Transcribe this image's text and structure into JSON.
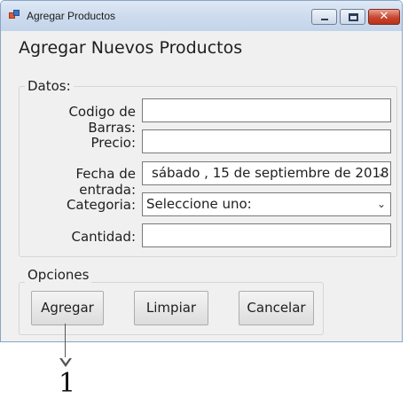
{
  "window": {
    "title": "Agregar Productos",
    "close_glyph": "✕"
  },
  "heading": "Agregar Nuevos Productos",
  "datos": {
    "legend": "Datos:",
    "fields": {
      "barcode": {
        "label": "Codigo de Barras:",
        "value": ""
      },
      "price": {
        "label": "Precio:",
        "value": ""
      },
      "date": {
        "label": "Fecha de entrada:",
        "value": "sábado  , 15 de septiembre de 2018"
      },
      "category": {
        "label": "Categoria:",
        "value": "Seleccione uno:"
      },
      "quantity": {
        "label": "Cantidad:",
        "value": ""
      }
    }
  },
  "opciones": {
    "legend": "Opciones",
    "buttons": {
      "add": "Agregar",
      "clear": "Limpiar",
      "cancel": "Cancelar"
    }
  },
  "annotation": {
    "number": "1"
  },
  "icons": {
    "app": "app-window-icon",
    "combo": "chevron-down-icon"
  },
  "colors": {
    "titlebar": "#cfdcee",
    "close": "#c9452f",
    "form_bg": "#f0f0f0"
  }
}
